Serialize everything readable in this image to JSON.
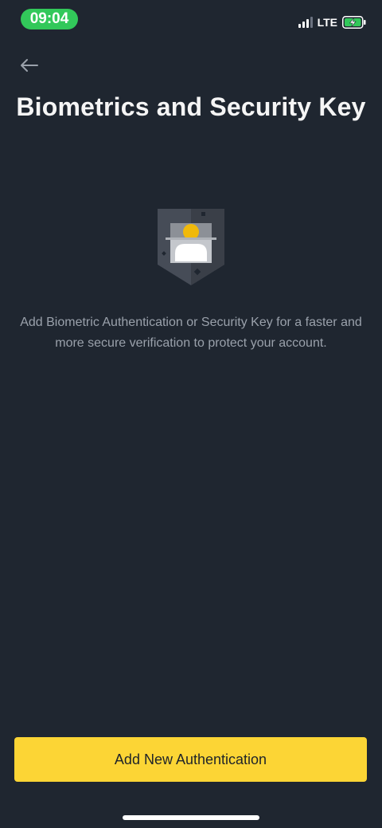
{
  "status_bar": {
    "time": "09:04",
    "network": "LTE",
    "signal_bars_active": 3,
    "signal_bars_total": 4,
    "battery_state": "charging",
    "time_pill_color": "#32c85a"
  },
  "header": {
    "back_icon": "arrow-left-icon",
    "title": "Biometrics and Security Key"
  },
  "illustration": {
    "icon": "shield-user-icon",
    "accent_color": "#f0b90b"
  },
  "main": {
    "description": "Add Biometric Authentication or Security Key for a faster and more secure verification to protect your account."
  },
  "footer": {
    "primary_button_label": "Add New Authentication",
    "primary_button_color": "#fcd535"
  },
  "theme": {
    "background": "#1f2630",
    "text_secondary": "#9aa1ab"
  }
}
